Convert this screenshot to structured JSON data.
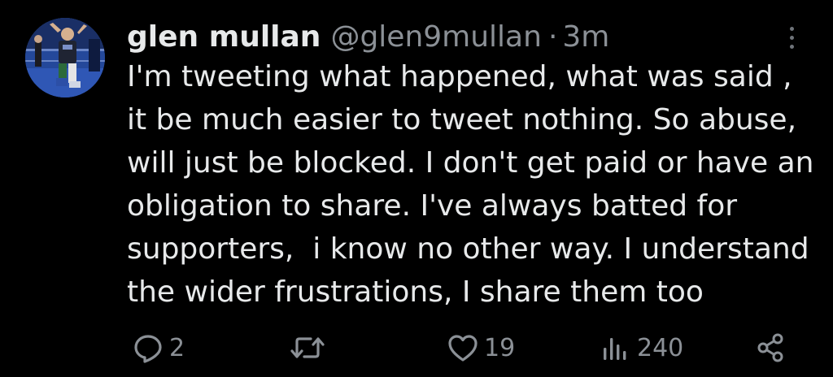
{
  "tweet": {
    "author_name": "glen mullan",
    "handle": "@glen9mullan",
    "separator": "·",
    "time": "3m",
    "lines": [
      "I'm tweeting what happened, what was said ,",
      "it be much easier to tweet nothing. So abuse,",
      "will just be blocked. I don't get paid or have an",
      "obligation to share. I've always batted for",
      "supporters,  i know no other way. I understand",
      "the wider frustrations, I share them too"
    ]
  },
  "actions": {
    "reply_count": "2",
    "retweet_count": "",
    "like_count": "19",
    "views_count": "240"
  },
  "icons": {
    "reply": "reply-icon",
    "retweet": "retweet-icon",
    "like": "heart-icon",
    "views": "views-icon",
    "share": "share-icon",
    "more": "more-vertical-icon"
  },
  "colors": {
    "background": "#000000",
    "text_primary": "#e7e9ea",
    "text_secondary": "#8b9096"
  }
}
